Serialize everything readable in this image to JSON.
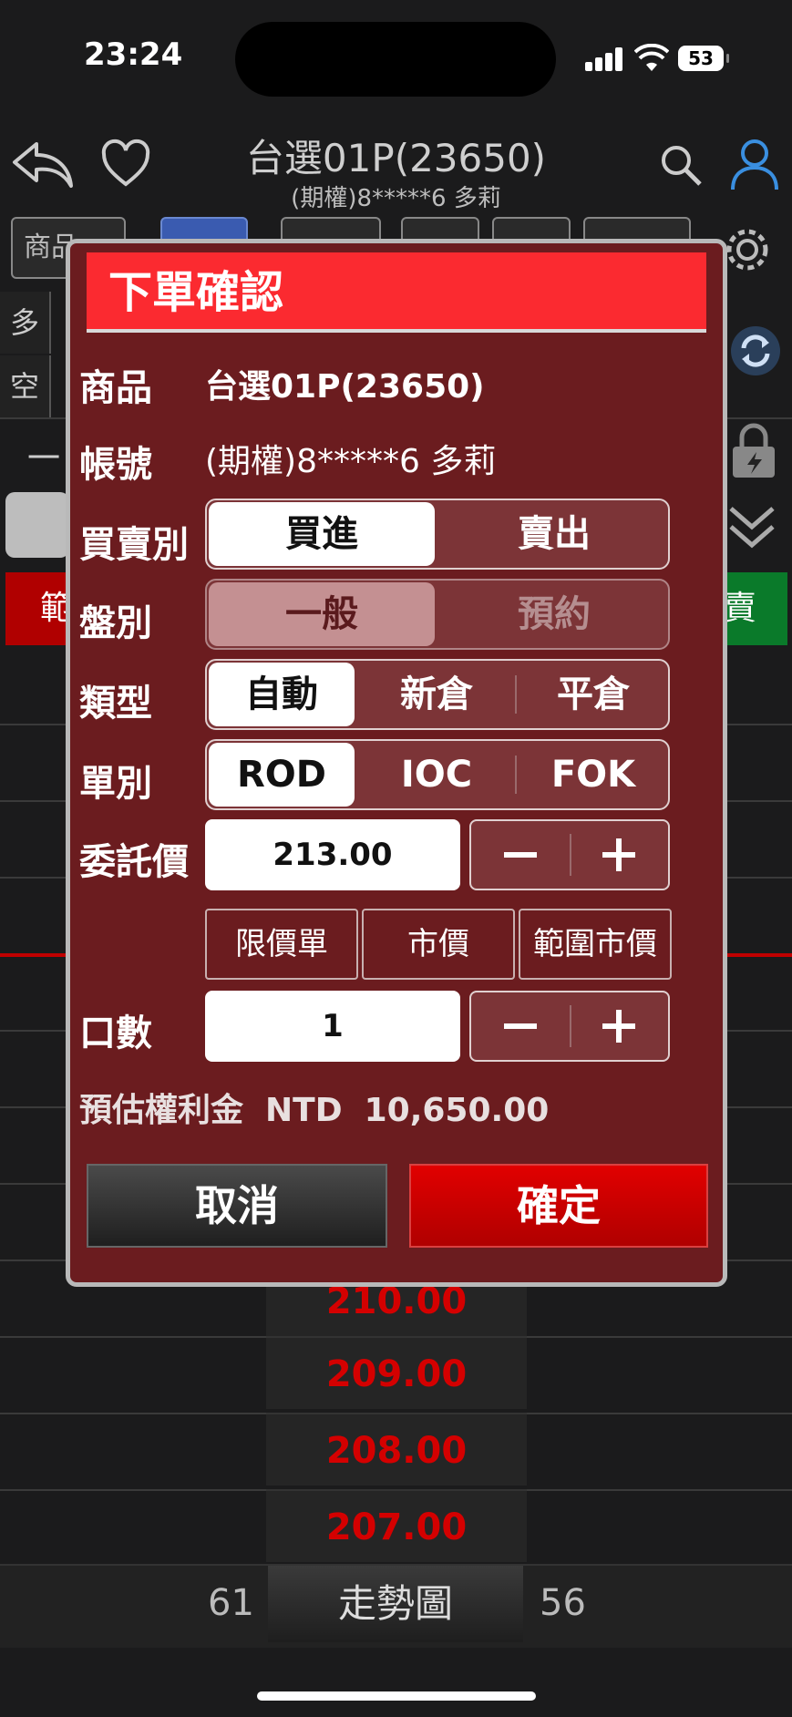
{
  "status_bar": {
    "time": "23:24",
    "battery": "53"
  },
  "header": {
    "title": "台選01P(23650)",
    "subtitle": "(期權)8*****6  多莉"
  },
  "background": {
    "tabs": [
      "商品",
      "",
      "",
      "",
      "",
      ""
    ],
    "side_labels": [
      "多",
      "空",
      "一"
    ],
    "left_button": "範",
    "right_button": "賣",
    "ladder_prices": [
      "210.00",
      "209.00",
      "208.00",
      "207.00"
    ],
    "bottom_left_value": "61",
    "bottom_right_value": "56",
    "trend_button": "走勢圖"
  },
  "dialog": {
    "title": "下單確認",
    "product_label": "商品",
    "product_value": "台選01P(23650)",
    "account_label": "帳號",
    "account_value": "(期權)8*****6  多莉",
    "side_label": "買賣別",
    "side_options": [
      "買進",
      "賣出"
    ],
    "session_label": "盤別",
    "session_options": [
      "一般",
      "預約"
    ],
    "type_label": "類型",
    "type_options": [
      "自動",
      "新倉",
      "平倉"
    ],
    "order_label": "單別",
    "order_options": [
      "ROD",
      "IOC",
      "FOK"
    ],
    "price_label": "委託價",
    "price_value": "213.00",
    "price_types": [
      "限價單",
      "市價",
      "範圍市價"
    ],
    "qty_label": "口數",
    "qty_value": "1",
    "premium_label": "預估權利金",
    "premium_currency": "NTD",
    "premium_value": "10,650.00",
    "cancel_button": "取消",
    "confirm_button": "確定"
  },
  "colors": {
    "dialog_bg": "#6b1c1f",
    "title_bar": "#fb2a30",
    "confirm": "#d00000",
    "ladder_price": "#d40000"
  }
}
